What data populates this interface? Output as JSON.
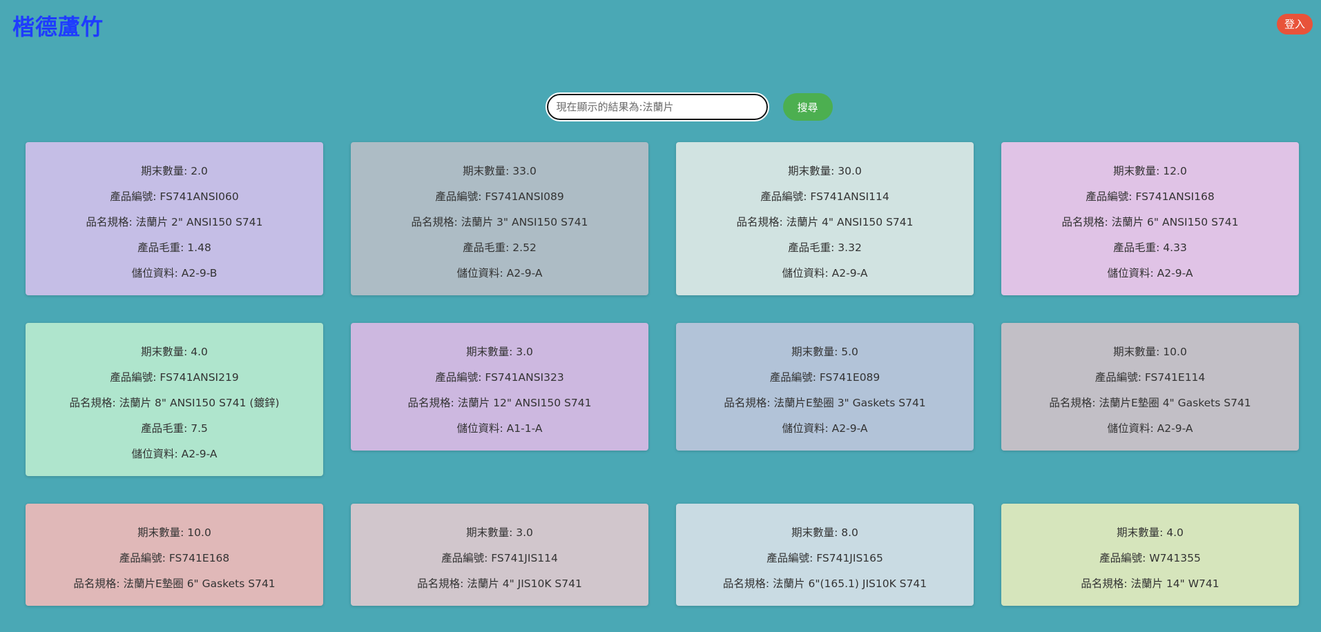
{
  "header": {
    "brand": "楷德蘆竹",
    "login_label": "登入"
  },
  "search": {
    "placeholder": "現在顯示的結果為:法蘭片",
    "button_label": "搜尋"
  },
  "cards": [
    {
      "bg": "#c5bee6",
      "qty": "期末數量: 2.0",
      "code": "產品編號: FS741ANSI060",
      "spec": "品名規格: 法蘭片 2\" ANSI150 S741",
      "weight": "產品毛重: 1.48",
      "location": "儲位資料: A2-9-B"
    },
    {
      "bg": "#adbcc5",
      "qty": "期末數量: 33.0",
      "code": "產品編號: FS741ANSI089",
      "spec": "品名規格: 法蘭片 3\" ANSI150 S741",
      "weight": "產品毛重: 2.52",
      "location": "儲位資料: A2-9-A"
    },
    {
      "bg": "#d1e3e1",
      "qty": "期末數量: 30.0",
      "code": "產品編號: FS741ANSI114",
      "spec": "品名規格: 法蘭片 4\" ANSI150 S741",
      "weight": "產品毛重: 3.32",
      "location": "儲位資料: A2-9-A"
    },
    {
      "bg": "#e0c3e6",
      "qty": "期末數量: 12.0",
      "code": "產品編號: FS741ANSI168",
      "spec": "品名規格: 法蘭片 6\" ANSI150 S741",
      "weight": "產品毛重: 4.33",
      "location": "儲位資料: A2-9-A"
    },
    {
      "bg": "#afe5cd",
      "qty": "期末數量: 4.0",
      "code": "產品編號: FS741ANSI219",
      "spec": "品名規格: 法蘭片 8\" ANSI150 S741 (鍍鋅)",
      "weight": "產品毛重: 7.5",
      "location": "儲位資料: A2-9-A"
    },
    {
      "bg": "#cdb8e0",
      "qty": "期末數量: 3.0",
      "code": "產品編號: FS741ANSI323",
      "spec": "品名規格: 法蘭片 12\" ANSI150 S741",
      "location": "儲位資料: A1-1-A"
    },
    {
      "bg": "#b2c3d8",
      "qty": "期末數量: 5.0",
      "code": "產品編號: FS741E089",
      "spec": "品名規格: 法蘭片E墊圈 3\" Gaskets S741",
      "location": "儲位資料: A2-9-A"
    },
    {
      "bg": "#c2bfc6",
      "qty": "期末數量: 10.0",
      "code": "產品編號: FS741E114",
      "spec": "品名規格: 法蘭片E墊圈 4\" Gaskets S741",
      "location": "儲位資料: A2-9-A"
    },
    {
      "bg": "#e0b8b8",
      "qty": "期末數量: 10.0",
      "code": "產品編號: FS741E168",
      "spec": "品名規格: 法蘭片E墊圈 6\" Gaskets S741"
    },
    {
      "bg": "#d1c6cc",
      "qty": "期末數量: 3.0",
      "code": "產品編號: FS741JIS114",
      "spec": "品名規格: 法蘭片 4\" JIS10K S741"
    },
    {
      "bg": "#c9dbe3",
      "qty": "期末數量: 8.0",
      "code": "產品編號: FS741JIS165",
      "spec": "品名規格: 法蘭片 6\"(165.1) JIS10K S741"
    },
    {
      "bg": "#d6e5bc",
      "qty": "期末數量: 4.0",
      "code": "產品編號: W741355",
      "spec": "品名規格: 法蘭片 14\" W741"
    }
  ]
}
